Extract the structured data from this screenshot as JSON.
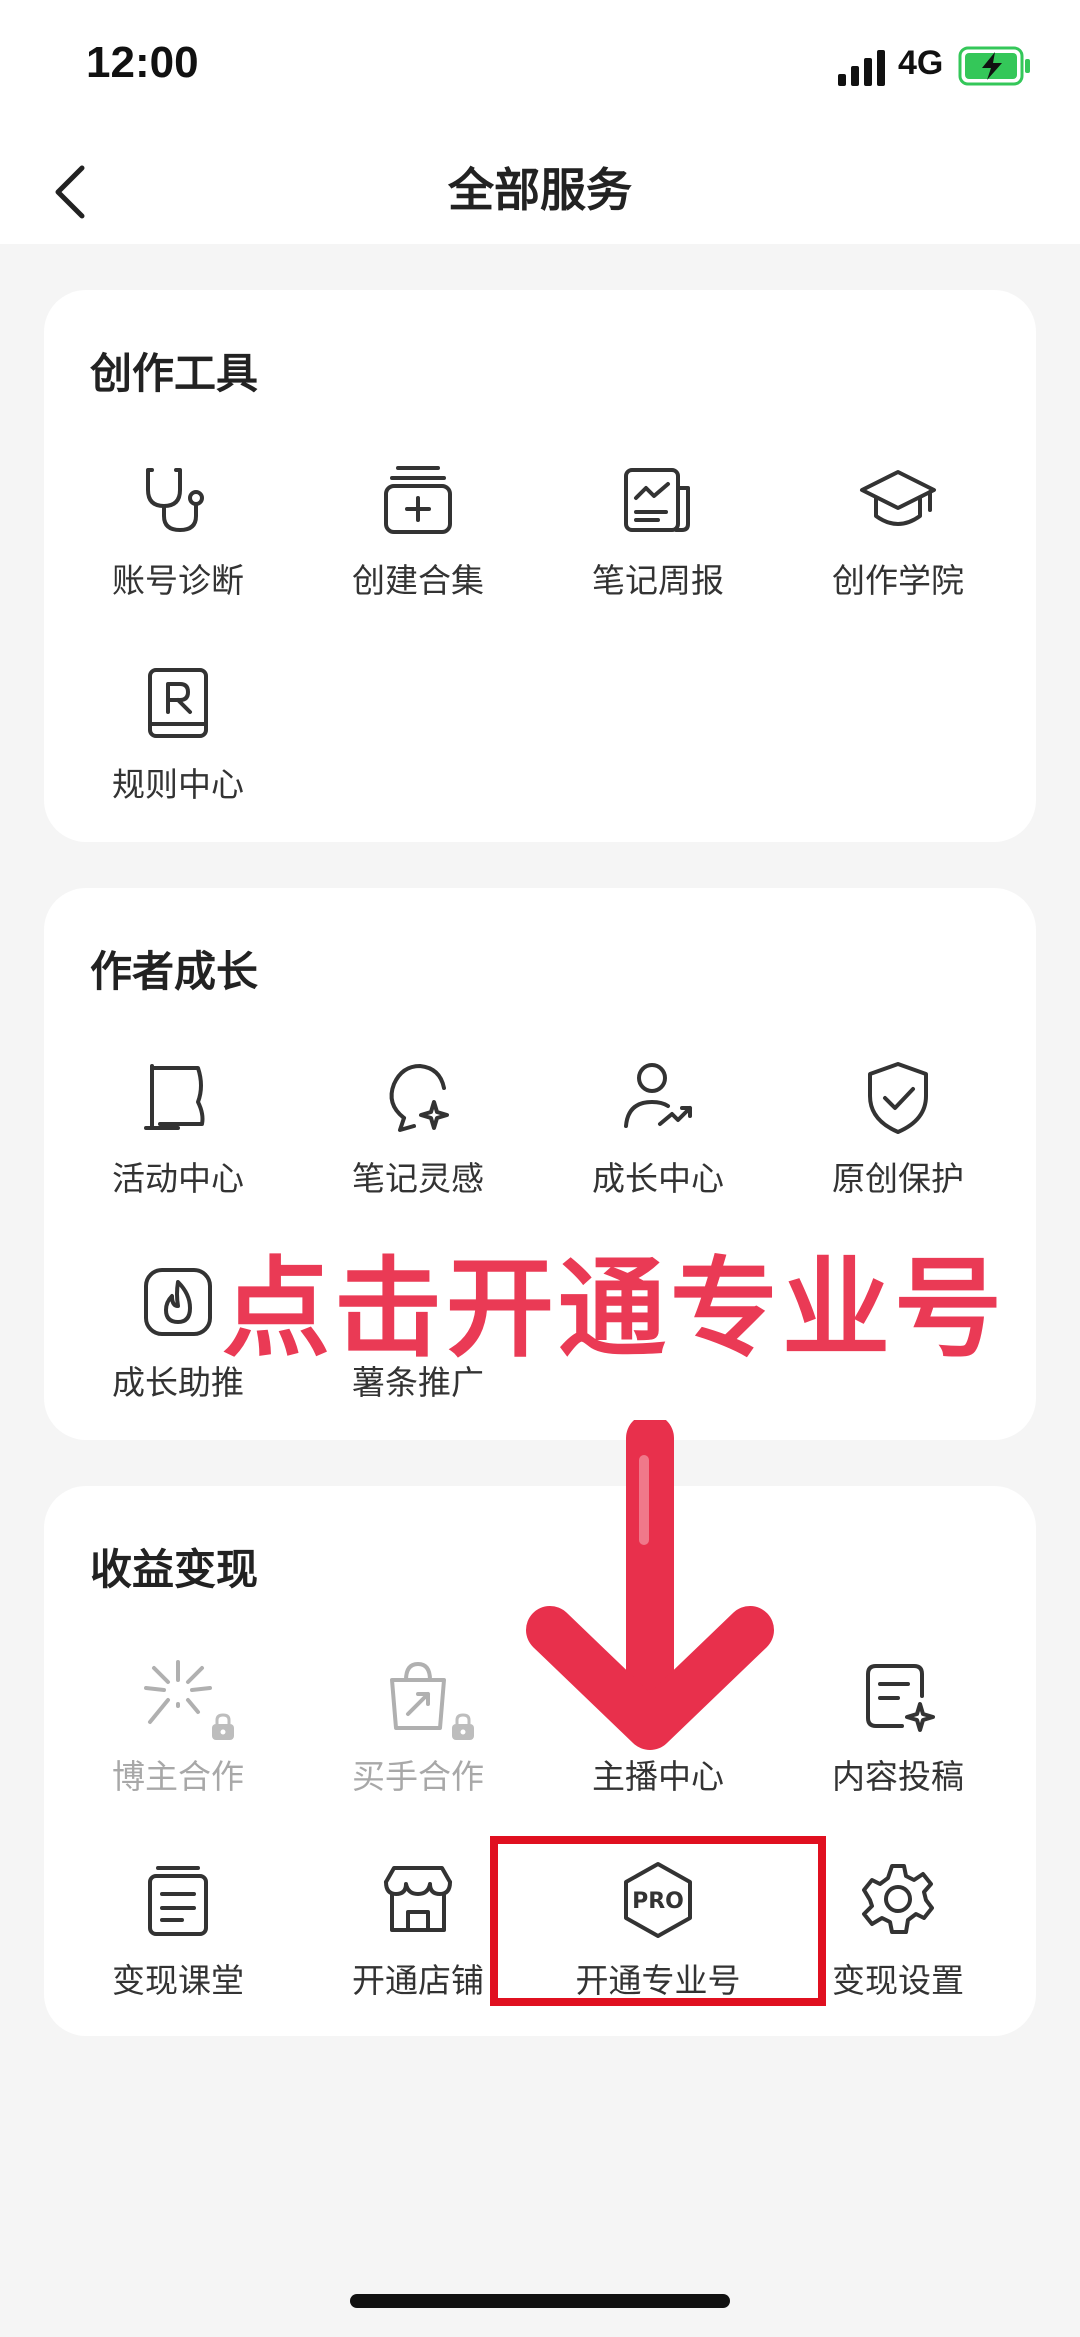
{
  "status_bar": {
    "time": "12:00",
    "network": "4G"
  },
  "nav": {
    "title": "全部服务"
  },
  "sections": {
    "create": {
      "title": "创作工具",
      "items": [
        "账号诊断",
        "创建合集",
        "笔记周报",
        "创作学院",
        "规则中心"
      ]
    },
    "growth": {
      "title": "作者成长",
      "items": [
        "活动中心",
        "笔记灵感",
        "成长中心",
        "原创保护",
        "成长助推",
        "薯条推广"
      ]
    },
    "monetize": {
      "title": "收益变现",
      "items": [
        "博主合作",
        "买手合作",
        "主播中心",
        "内容投稿",
        "变现课堂",
        "开通店铺",
        "开通专业号",
        "变现设置"
      ],
      "pro_badge": "PRO"
    }
  },
  "overlay": {
    "caption": "点击开通专业号"
  },
  "colors": {
    "accent_red": "#ea3a55",
    "box_red": "#e01020",
    "battery_green": "#34c759"
  }
}
